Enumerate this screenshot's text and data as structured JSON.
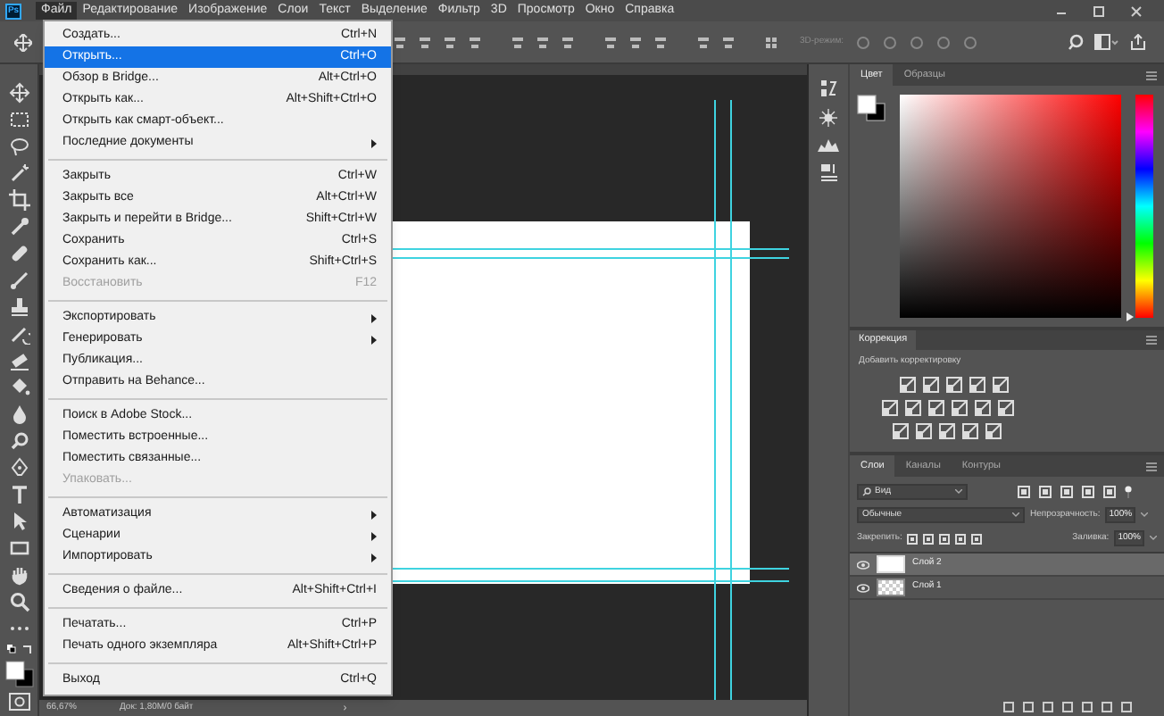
{
  "app_logo": "Ps",
  "menu_bar": [
    {
      "label": "Файл",
      "selected": true
    },
    {
      "label": "Редактирование",
      "selected": false
    },
    {
      "label": "Изображение",
      "selected": false
    },
    {
      "label": "Слои",
      "selected": false
    },
    {
      "label": "Текст",
      "selected": false
    },
    {
      "label": "Выделение",
      "selected": false
    },
    {
      "label": "Фильтр",
      "selected": false
    },
    {
      "label": "3D",
      "selected": false
    },
    {
      "label": "Просмотр",
      "selected": false
    },
    {
      "label": "Окно",
      "selected": false
    },
    {
      "label": "Справка",
      "selected": false
    }
  ],
  "options_bar": {
    "mode_label": "3D-режим:"
  },
  "file_menu": [
    {
      "kind": "item",
      "label": "Создать...",
      "shortcut": "Ctrl+N",
      "selected": false,
      "disabled": false,
      "submenu": false
    },
    {
      "kind": "item",
      "label": "Открыть...",
      "shortcut": "Ctrl+O",
      "selected": true,
      "disabled": false,
      "submenu": false
    },
    {
      "kind": "item",
      "label": "Обзор в Bridge...",
      "shortcut": "Alt+Ctrl+O",
      "selected": false,
      "disabled": false,
      "submenu": false
    },
    {
      "kind": "item",
      "label": "Открыть как...",
      "shortcut": "Alt+Shift+Ctrl+O",
      "selected": false,
      "disabled": false,
      "submenu": false
    },
    {
      "kind": "item",
      "label": "Открыть как смарт-объект...",
      "selected": false,
      "disabled": false,
      "submenu": false
    },
    {
      "kind": "item",
      "label": "Последние документы",
      "selected": false,
      "disabled": false,
      "submenu": true
    },
    {
      "kind": "separator"
    },
    {
      "kind": "item",
      "label": "Закрыть",
      "shortcut": "Ctrl+W",
      "selected": false,
      "disabled": false,
      "submenu": false
    },
    {
      "kind": "item",
      "label": "Закрыть все",
      "shortcut": "Alt+Ctrl+W",
      "selected": false,
      "disabled": false,
      "submenu": false
    },
    {
      "kind": "item",
      "label": "Закрыть и перейти в Bridge...",
      "shortcut": "Shift+Ctrl+W",
      "selected": false,
      "disabled": false,
      "submenu": false
    },
    {
      "kind": "item",
      "label": "Сохранить",
      "shortcut": "Ctrl+S",
      "selected": false,
      "disabled": false,
      "submenu": false
    },
    {
      "kind": "item",
      "label": "Сохранить как...",
      "shortcut": "Shift+Ctrl+S",
      "selected": false,
      "disabled": false,
      "submenu": false
    },
    {
      "kind": "item",
      "label": "Восстановить",
      "shortcut": "F12",
      "selected": false,
      "disabled": true,
      "submenu": false
    },
    {
      "kind": "separator"
    },
    {
      "kind": "item",
      "label": "Экспортировать",
      "selected": false,
      "disabled": false,
      "submenu": true
    },
    {
      "kind": "item",
      "label": "Генерировать",
      "selected": false,
      "disabled": false,
      "submenu": true
    },
    {
      "kind": "item",
      "label": "Публикация...",
      "selected": false,
      "disabled": false,
      "submenu": false
    },
    {
      "kind": "item",
      "label": "Отправить на Behance...",
      "selected": false,
      "disabled": false,
      "submenu": false
    },
    {
      "kind": "separator"
    },
    {
      "kind": "item",
      "label": "Поиск в Adobe Stock...",
      "selected": false,
      "disabled": false,
      "submenu": false
    },
    {
      "kind": "item",
      "label": "Поместить встроенные...",
      "selected": false,
      "disabled": false,
      "submenu": false
    },
    {
      "kind": "item",
      "label": "Поместить связанные...",
      "selected": false,
      "disabled": false,
      "submenu": false
    },
    {
      "kind": "item",
      "label": "Упаковать...",
      "selected": false,
      "disabled": true,
      "submenu": false
    },
    {
      "kind": "separator"
    },
    {
      "kind": "item",
      "label": "Автоматизация",
      "selected": false,
      "disabled": false,
      "submenu": true
    },
    {
      "kind": "item",
      "label": "Сценарии",
      "selected": false,
      "disabled": false,
      "submenu": true
    },
    {
      "kind": "item",
      "label": "Импортировать",
      "selected": false,
      "disabled": false,
      "submenu": true
    },
    {
      "kind": "separator"
    },
    {
      "kind": "item",
      "label": "Сведения о файле...",
      "shortcut": "Alt+Shift+Ctrl+I",
      "selected": false,
      "disabled": false,
      "submenu": false
    },
    {
      "kind": "separator"
    },
    {
      "kind": "item",
      "label": "Печатать...",
      "shortcut": "Ctrl+P",
      "selected": false,
      "disabled": false,
      "submenu": false
    },
    {
      "kind": "item",
      "label": "Печать одного экземпляра",
      "shortcut": "Alt+Shift+Ctrl+P",
      "selected": false,
      "disabled": false,
      "submenu": false
    },
    {
      "kind": "separator"
    },
    {
      "kind": "item",
      "label": "Выход",
      "shortcut": "Ctrl+Q",
      "selected": false,
      "disabled": false,
      "submenu": false
    }
  ],
  "color_panel": {
    "hue": {
      "level": 0
    },
    "tabs": [
      {
        "label": "Цвет",
        "selected": true
      },
      {
        "label": "Образцы",
        "selected": false
      }
    ]
  },
  "adjustments_panel": {
    "title": "Коррекция",
    "subtitle": "Добавить корректировку"
  },
  "layers_panel": {
    "tabs": [
      {
        "label": "Слои",
        "selected": true
      },
      {
        "label": "Каналы",
        "selected": false
      },
      {
        "label": "Контуры",
        "selected": false
      }
    ],
    "filter": "Вид",
    "blend_mode": "Обычные",
    "opacity_label": "Непрозрачность:",
    "opacity": "100%",
    "lock_label": "Закрепить:",
    "fill_label": "Заливка:",
    "fill": "100%",
    "layers": [
      {
        "name": "Слой 2",
        "kind": "white",
        "selected": true,
        "visible": true
      },
      {
        "name": "Слой 1",
        "kind": "transparent",
        "selected": false,
        "visible": true
      }
    ]
  },
  "status_bar": {
    "zoom": "66,67%",
    "document": "Док: 1,80M/0 байт",
    "arrow": "›"
  }
}
